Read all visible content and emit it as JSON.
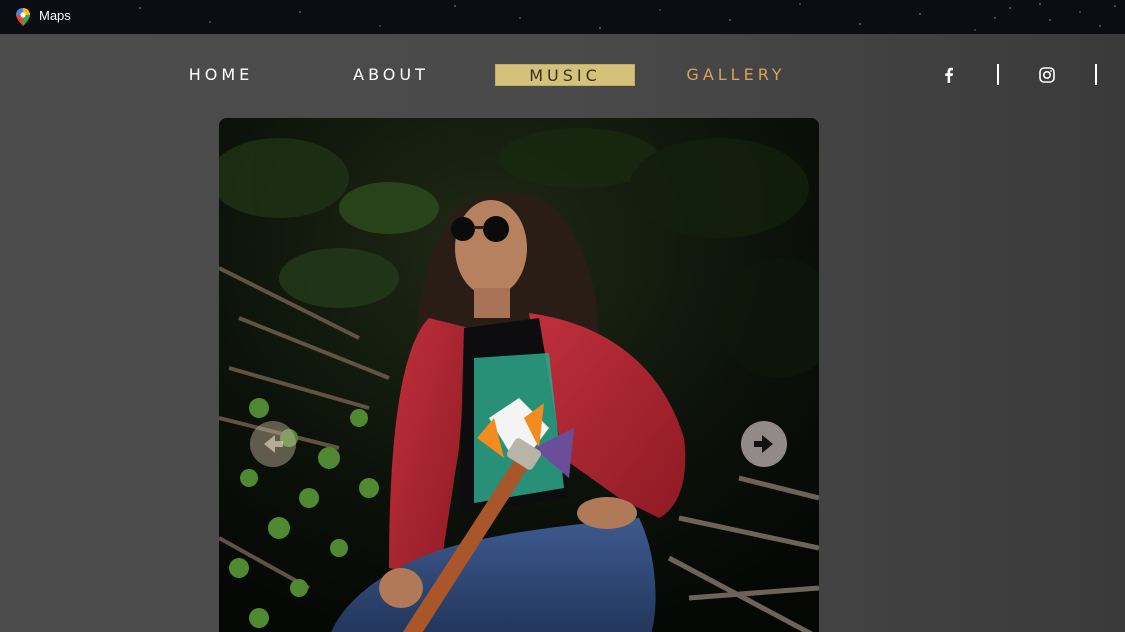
{
  "window": {
    "title": "Maps",
    "icon": "maps-pin-icon"
  },
  "nav": {
    "items": [
      {
        "label": "HOME"
      },
      {
        "label": "ABOUT"
      },
      {
        "label": "MUSIC",
        "active": true
      },
      {
        "label": "GALLERY"
      }
    ],
    "active_color": "#d4c27a",
    "gallery_color": "#d9a257"
  },
  "social": {
    "icons": [
      "facebook-icon",
      "instagram-icon"
    ]
  },
  "slideshow": {
    "prev_icon": "arrow-left-icon",
    "next_icon": "arrow-right-icon"
  }
}
